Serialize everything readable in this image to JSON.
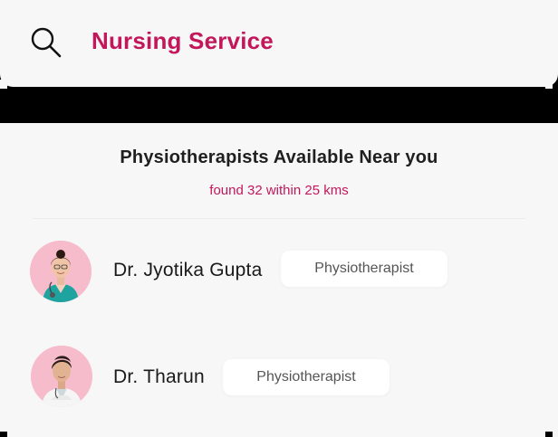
{
  "search": {
    "icon": "search-icon",
    "query": "Nursing Service"
  },
  "results": {
    "title": "Physiotherapists Available Near you",
    "subtitle": "found 32 within 25 kms"
  },
  "doctors": [
    {
      "name": "Dr. Jyotika Gupta",
      "role": "Physiotherapist",
      "avatar": "female-doctor-avatar"
    },
    {
      "name": "Dr. Tharun",
      "role": "Physiotherapist",
      "avatar": "male-doctor-avatar"
    }
  ],
  "colors": {
    "accent": "#c2185b",
    "avatar_bg": "#f7bccc",
    "card_bg": "#f7f7f7"
  }
}
